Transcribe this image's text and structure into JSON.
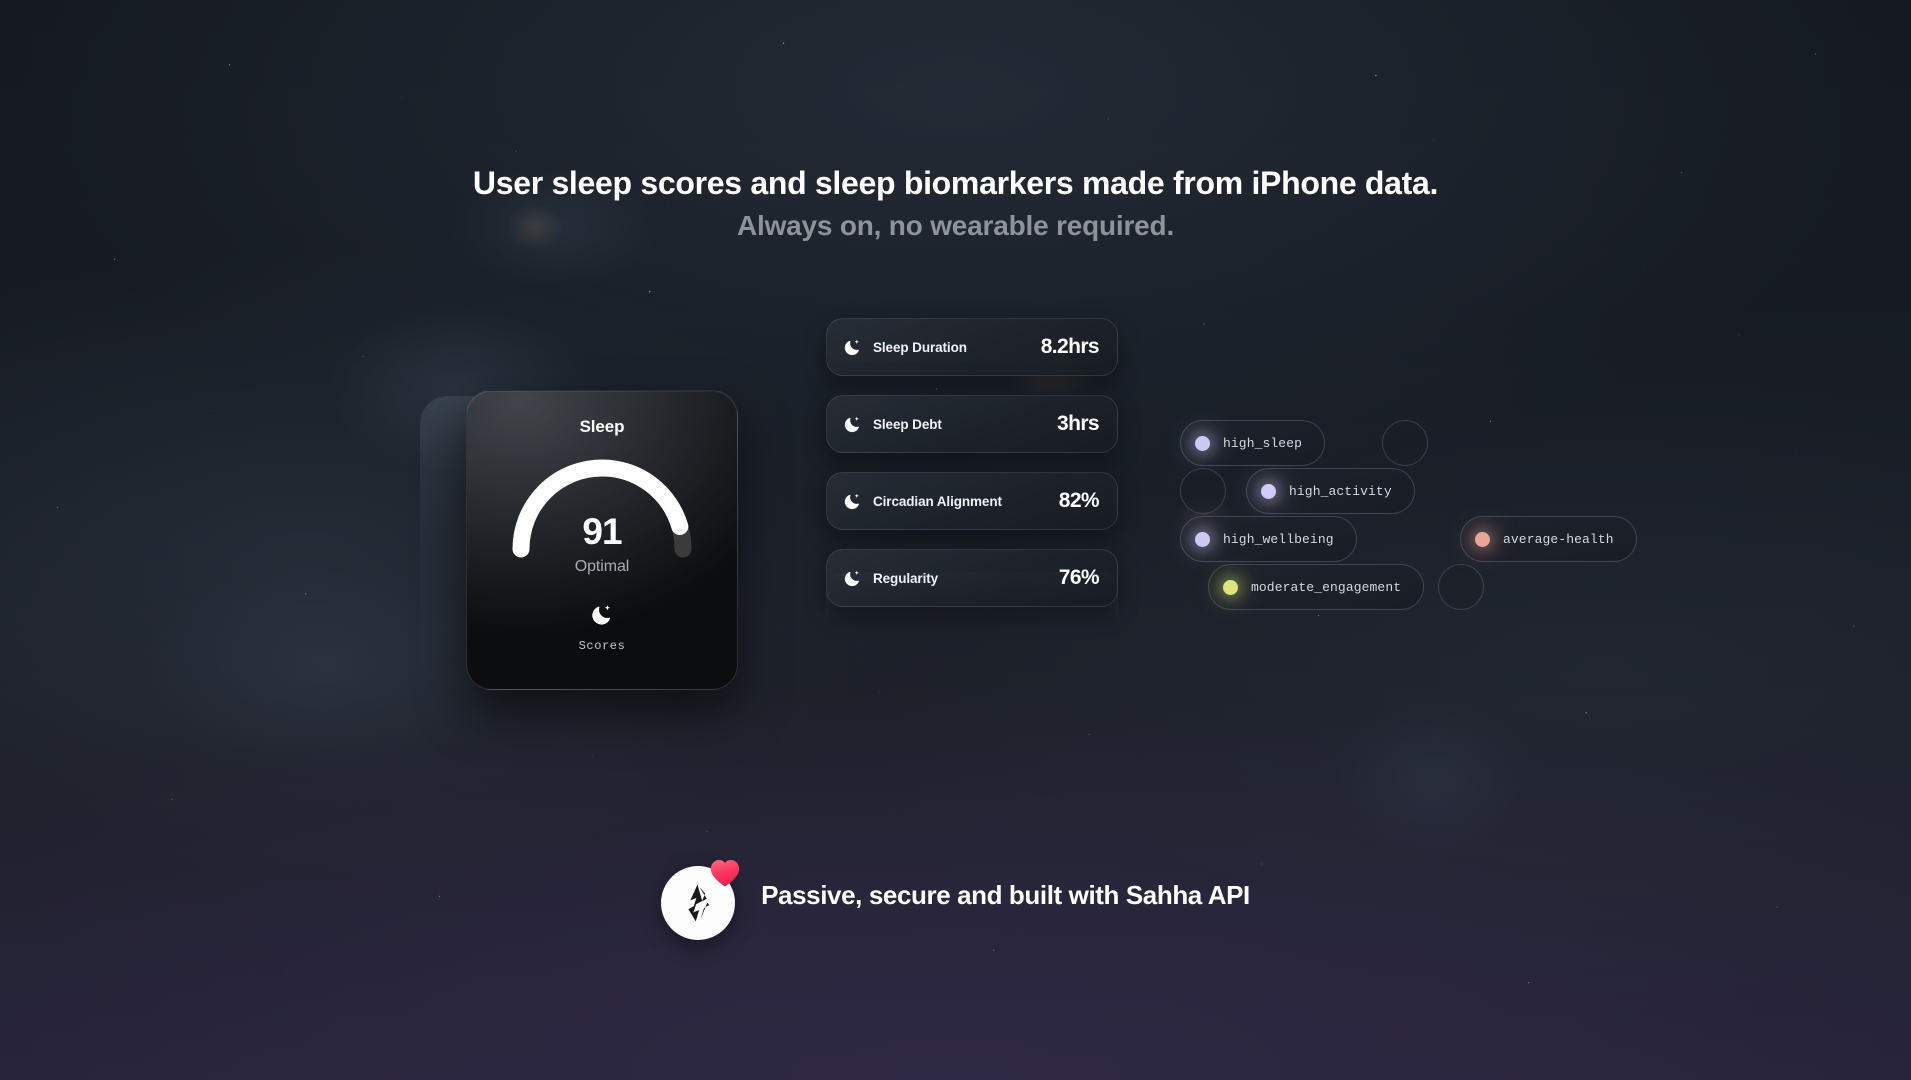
{
  "headline": {
    "line1": "User sleep scores and sleep biomarkers made from iPhone data.",
    "line2": "Always on, no wearable required."
  },
  "score_card": {
    "title": "Sleep",
    "value": "91",
    "value_number": 91,
    "state": "Optimal",
    "footer_label": "Scores",
    "footer_icon": "moon-sparkle-icon",
    "arc_fill_percent": 91,
    "arc_color": "#ffffff",
    "arc_track_color": "#3b3b3b"
  },
  "biomarkers": [
    {
      "icon": "moon-sparkle-icon",
      "label": "Sleep Duration",
      "value": "8.2hrs"
    },
    {
      "icon": "moon-sparkle-icon",
      "label": "Sleep Debt",
      "value": "3hrs"
    },
    {
      "icon": "moon-sparkle-icon",
      "label": "Circadian Alignment",
      "value": "82%"
    },
    {
      "icon": "moon-sparkle-icon",
      "label": "Regularity",
      "value": "76%"
    }
  ],
  "archetypes": [
    {
      "label": "high_sleep",
      "dot_color": "#cdc9f5"
    },
    {
      "label": "high_activity",
      "dot_color": "#d0ccf7"
    },
    {
      "label": "high_wellbeing",
      "dot_color": "#cdc9f5"
    },
    {
      "label": "average-health",
      "dot_color": "#e8a598"
    },
    {
      "label": "moderate_engagement",
      "dot_color": "#dbe67a"
    }
  ],
  "footer": {
    "text": "Passive, secure and built with Sahha API",
    "logo_icon": "sahha-logo-icon",
    "badge_icon": "heart-icon",
    "badge_color": "#f5365c"
  }
}
